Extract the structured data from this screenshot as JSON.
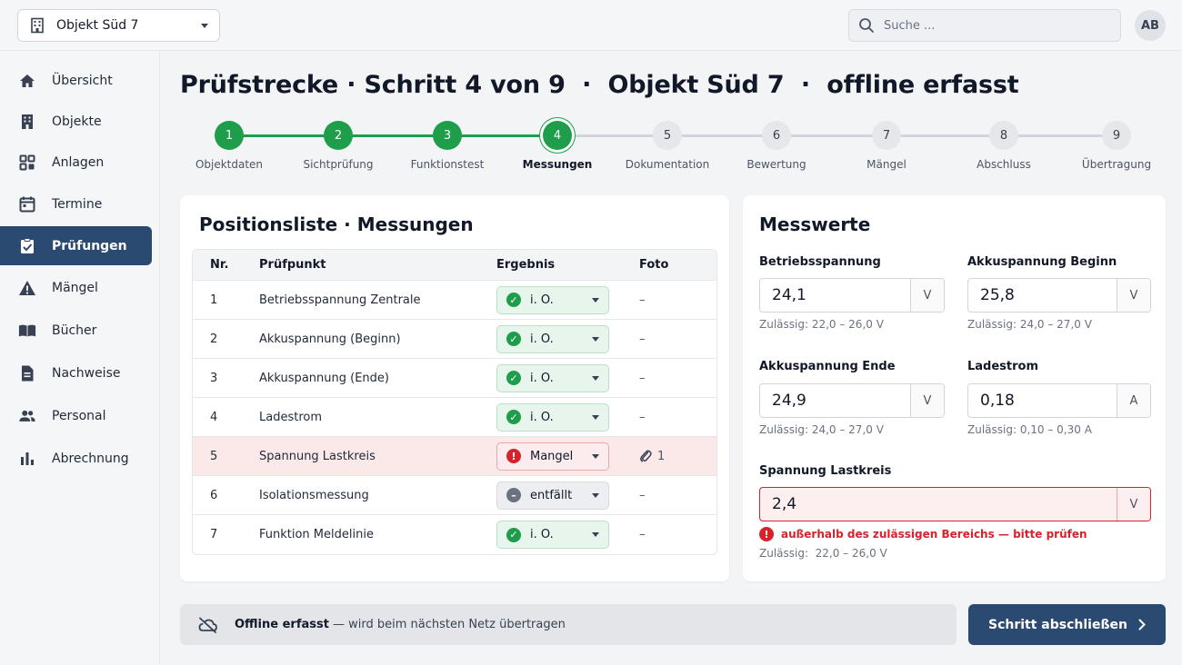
{
  "header": {
    "object_select": "Objekt Süd 7",
    "search_placeholder": "Suche ...",
    "avatar_initials": "AB"
  },
  "sidebar": {
    "items": [
      {
        "label": "Übersicht",
        "icon": "home-icon"
      },
      {
        "label": "Objekte",
        "icon": "building-icon"
      },
      {
        "label": "Anlagen",
        "icon": "grid-icon"
      },
      {
        "label": "Termine",
        "icon": "calendar-icon"
      },
      {
        "label": "Prüfungen",
        "icon": "checklist-icon",
        "active": true
      },
      {
        "label": "Mängel",
        "icon": "warning-icon"
      },
      {
        "label": "Bücher",
        "icon": "book-icon"
      },
      {
        "label": "Nachweise",
        "icon": "document-icon"
      },
      {
        "label": "Personal",
        "icon": "people-icon"
      },
      {
        "label": "Abrechnung",
        "icon": "bar-chart-icon"
      }
    ]
  },
  "page": {
    "title": "Prüfstrecke · Schritt 4 von 9  ·  Objekt Süd 7  ·  offline erfasst"
  },
  "stepper": {
    "current": 4,
    "steps": [
      {
        "num": "1",
        "label": "Objektdaten"
      },
      {
        "num": "2",
        "label": "Sichtprüfung"
      },
      {
        "num": "3",
        "label": "Funktionstest"
      },
      {
        "num": "4",
        "label": "Messungen"
      },
      {
        "num": "5",
        "label": "Dokumentation"
      },
      {
        "num": "6",
        "label": "Bewertung"
      },
      {
        "num": "7",
        "label": "Mängel"
      },
      {
        "num": "8",
        "label": "Abschluss"
      },
      {
        "num": "9",
        "label": "Übertragung"
      }
    ]
  },
  "positions": {
    "title": "Positionsliste · Messungen",
    "columns": {
      "nr": "Nr.",
      "pruefpunkt": "Prüfpunkt",
      "ergebnis": "Ergebnis",
      "foto": "Foto"
    },
    "rows": [
      {
        "nr": "1",
        "name": "Betriebsspannung Zentrale",
        "result": "i. O.",
        "status": "ok",
        "foto": "–"
      },
      {
        "nr": "2",
        "name": "Akkuspannung (Beginn)",
        "result": "i. O.",
        "status": "ok",
        "foto": "–"
      },
      {
        "nr": "3",
        "name": "Akkuspannung (Ende)",
        "result": "i. O.",
        "status": "ok",
        "foto": "–"
      },
      {
        "nr": "4",
        "name": "Ladestrom",
        "result": "i. O.",
        "status": "ok",
        "foto": "–"
      },
      {
        "nr": "5",
        "name": "Spannung Lastkreis",
        "result": "Mangel",
        "status": "bad",
        "foto": "1"
      },
      {
        "nr": "6",
        "name": "Isolationsmessung",
        "result": "entfällt",
        "status": "na",
        "foto": "–"
      },
      {
        "nr": "7",
        "name": "Funktion Meldelinie",
        "result": "i. O.",
        "status": "ok",
        "foto": "–"
      }
    ]
  },
  "messwerte": {
    "title": "Messwerte",
    "fields": {
      "betriebsspannung": {
        "label": "Betriebsspannung",
        "value": "24,1",
        "unit": "V",
        "hint": "Zulässig: 22,0 – 26,0 V"
      },
      "akku_beginn": {
        "label": "Akkuspannung Beginn",
        "value": "25,8",
        "unit": "V",
        "hint": "Zulässig: 24,0 – 27,0 V"
      },
      "akku_ende": {
        "label": "Akkuspannung Ende",
        "value": "24,9",
        "unit": "V",
        "hint": "Zulässig: 24,0 – 27,0 V"
      },
      "ladestrom": {
        "label": "Ladestrom",
        "value": "0,18",
        "unit": "A",
        "hint": "Zulässig: 0,10 – 0,30 A"
      },
      "lastkreis": {
        "label": "Spannung Lastkreis",
        "value": "2,4",
        "unit": "V",
        "error": "außerhalb des zulässigen Bereichs — bitte prüfen",
        "hint": "Zulässig:  22,0 – 26,0 V"
      }
    }
  },
  "footer": {
    "offline_bold": "Offline erfasst",
    "offline_rest": "— wird beim nächsten Netz übertragen",
    "primary_button": "Schritt abschließen"
  },
  "colors": {
    "primary": "#2b4a72",
    "success": "#1e9e4a",
    "error": "#d5222b"
  }
}
